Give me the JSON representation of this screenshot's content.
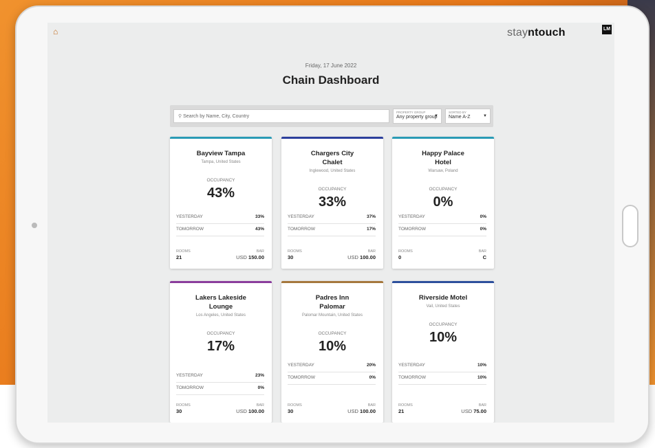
{
  "app": {
    "brand_light": "stay",
    "brand_mid": "n",
    "brand_bold": "touch",
    "user_initials": "LM",
    "date": "Friday, 17 June 2022",
    "title": "Chain Dashboard"
  },
  "filters": {
    "search_placeholder": "Search by Name, City, Country",
    "group_label": "PROPERTY GROUP",
    "group_value": "Any property group",
    "sort_label": "SORTED BY",
    "sort_value": "Name A-Z"
  },
  "labels": {
    "occupancy": "OCCUPANCY",
    "yesterday": "YESTERDAY",
    "tomorrow": "TOMORROW",
    "rooms": "ROOMS",
    "bar": "BAR"
  },
  "properties": [
    {
      "name": "Bayview Tampa",
      "location": "Tampa, United States",
      "occupancy": "43%",
      "yesterday": "33%",
      "tomorrow": "43%",
      "rooms": "21",
      "bar_currency": "USD",
      "bar_value": "150.00",
      "accent": "#2a9bb5"
    },
    {
      "name": "Chargers City Chalet",
      "location": "Inglewood, United States",
      "occupancy": "33%",
      "yesterday": "37%",
      "tomorrow": "17%",
      "rooms": "30",
      "bar_currency": "USD",
      "bar_value": "100.00",
      "accent": "#2c3f9c"
    },
    {
      "name": "Happy Palace Hotel",
      "location": "Warsaw, Poland",
      "occupancy": "0%",
      "yesterday": "0%",
      "tomorrow": "0%",
      "rooms": "0",
      "bar_currency": "",
      "bar_value": "C",
      "accent": "#2a9bb5"
    },
    {
      "name": "Lakers Lakeside Lounge",
      "location": "Los Angeles, United States",
      "occupancy": "17%",
      "yesterday": "23%",
      "tomorrow": "0%",
      "rooms": "30",
      "bar_currency": "USD",
      "bar_value": "100.00",
      "accent": "#8a3c9c"
    },
    {
      "name": "Padres Inn Palomar",
      "location": "Palomar Mountain, United States",
      "occupancy": "10%",
      "yesterday": "20%",
      "tomorrow": "0%",
      "rooms": "30",
      "bar_currency": "USD",
      "bar_value": "100.00",
      "accent": "#a5773c"
    },
    {
      "name": "Riverside Motel",
      "location": "Vail, United States",
      "occupancy": "10%",
      "yesterday": "10%",
      "tomorrow": "10%",
      "rooms": "21",
      "bar_currency": "USD",
      "bar_value": "75.00",
      "accent": "#2c4f9c"
    }
  ]
}
